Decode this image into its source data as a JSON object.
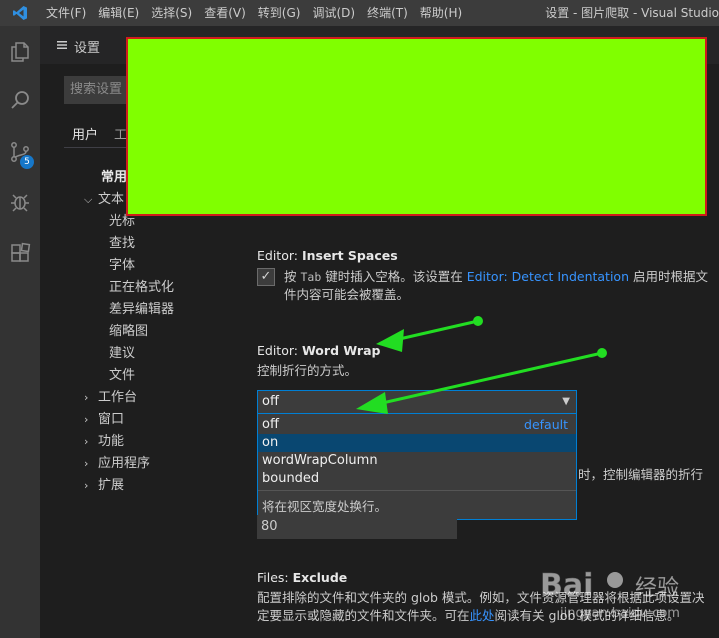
{
  "titlebar": {
    "menu": [
      "文件(F)",
      "编辑(E)",
      "选择(S)",
      "查看(V)",
      "转到(G)",
      "调试(D)",
      "终端(T)",
      "帮助(H)"
    ],
    "window_title": "设置 - 图片爬取 - Visual Studio"
  },
  "activity": {
    "icons": [
      "explorer-icon",
      "search-icon",
      "source-control-icon",
      "debug-icon",
      "extensions-icon"
    ],
    "scm_badge": "5"
  },
  "settings": {
    "tab_label": "设置",
    "search_placeholder": "搜索设置",
    "scope_tabs": [
      "用户",
      "工"
    ]
  },
  "tree": {
    "common": "常用",
    "text_editor": "文本",
    "children": [
      "光标",
      "查找",
      "字体",
      "正在格式化",
      "差异编辑器",
      "缩略图",
      "建议",
      "文件"
    ],
    "groups": [
      "工作台",
      "窗口",
      "功能",
      "应用程序",
      "扩展"
    ]
  },
  "insert_spaces": {
    "category": "Editor: ",
    "name": "Insert Spaces",
    "desc_pre": "按 ",
    "desc_code": "Tab",
    "desc_mid": " 键时插入空格。该设置在 ",
    "desc_link": "Editor: Detect Indentation",
    "desc_post": " 启用时根据文",
    "desc_line2": "件内容可能会被覆盖。",
    "checked": true
  },
  "word_wrap": {
    "category": "Editor: ",
    "name": "Word Wrap",
    "desc": "控制折行的方式。",
    "selected": "off",
    "options": [
      "off",
      "on",
      "wordWrapColumn",
      "bounded"
    ],
    "default_tag": "default",
    "highlighted_option": "on",
    "option_desc": "将在视区宽度处换行。"
  },
  "wrap_column": {
    "desc_partial": "时，控制编辑器的折行",
    "value": "80"
  },
  "files_exclude": {
    "category": "Files: ",
    "name": "Exclude",
    "desc_line1": "配置排除的文件和文件夹的 glob 模式。例如，文件资源管理器将根据此项设置决",
    "desc_line2_pre": "定要显示或隐藏的文件和文件夹。可在",
    "desc_link": "此处",
    "desc_line2_post": "阅读有关 glob 模式的详细信息。"
  },
  "colors": {
    "overlay": "#80ff00",
    "overlay_border": "#d01c1c",
    "arrow": "#22dd22",
    "accent": "#007fd4"
  }
}
